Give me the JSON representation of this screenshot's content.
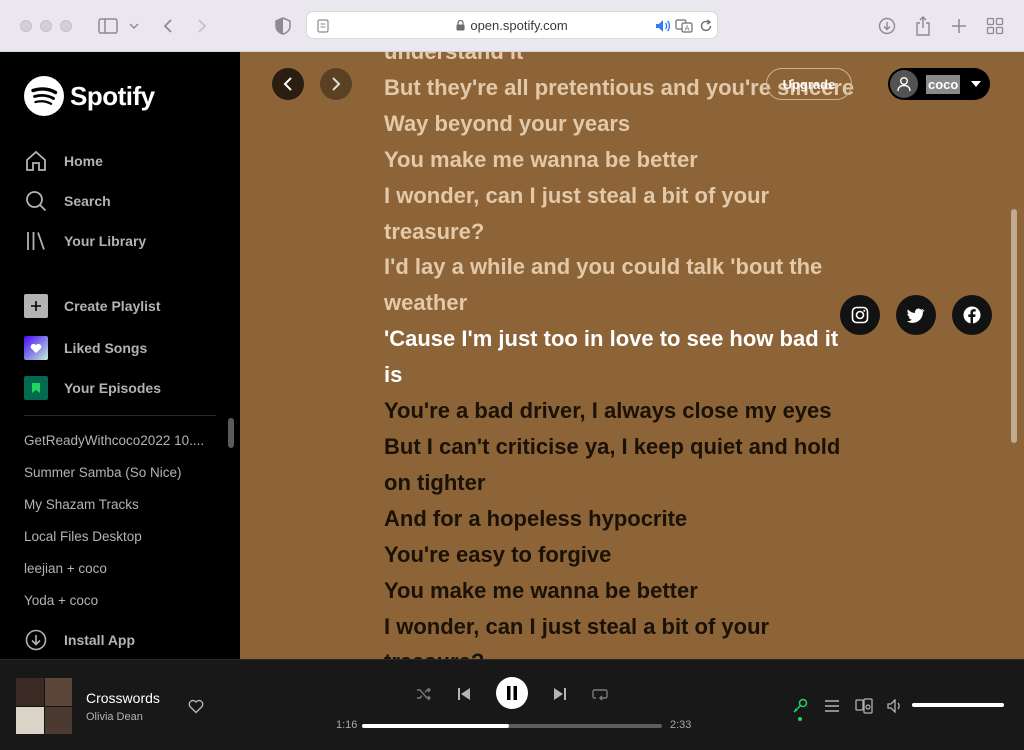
{
  "browser": {
    "url": "open.spotify.com"
  },
  "sidebar": {
    "logo_text": "Spotify",
    "nav": [
      {
        "label": "Home",
        "icon": "home-icon"
      },
      {
        "label": "Search",
        "icon": "search-icon"
      },
      {
        "label": "Your Library",
        "icon": "library-icon"
      }
    ],
    "actions": [
      {
        "label": "Create Playlist",
        "icon": "plus-icon"
      },
      {
        "label": "Liked Songs",
        "icon": "heart-icon"
      },
      {
        "label": "Your Episodes",
        "icon": "bookmark-icon"
      }
    ],
    "playlists": [
      "GetReadyWithcoco2022 10....",
      "Summer Samba (So Nice)",
      "My Shazam Tracks",
      "Local Files Desktop",
      "leejian + coco",
      "Yoda + coco"
    ],
    "install_label": "Install App"
  },
  "header": {
    "upgrade_label": "Upgrade",
    "username": "coco"
  },
  "lyrics": {
    "past": [
      "understand it",
      "But they're all pretentious and you're sincere",
      "Way beyond your years",
      "You make me wanna be better",
      "I wonder, can I just steal a bit of your",
      "treasure?",
      "I'd lay a while and you could talk 'bout the",
      "weather"
    ],
    "current": [
      "'Cause I'm just too in love to see how bad it",
      "is"
    ],
    "future": [
      "You're a bad driver, I always close my eyes",
      "But I can't criticise ya, I keep quiet and hold",
      "on tighter",
      "And for a hopeless hypocrite",
      "You're easy to forgive",
      "You make me wanna be better",
      "I wonder, can I just steal a bit of your",
      "treasure?"
    ]
  },
  "player": {
    "title": "Crosswords",
    "artist": "Olivia Dean",
    "elapsed": "1:16",
    "duration": "2:33",
    "progress_fraction": 0.49,
    "volume_fraction": 1.0,
    "accent_color": "#1ed760"
  },
  "colors": {
    "lyrics_background": "#8d6437",
    "sidebar_background": "#000000",
    "player_background": "#181818"
  }
}
